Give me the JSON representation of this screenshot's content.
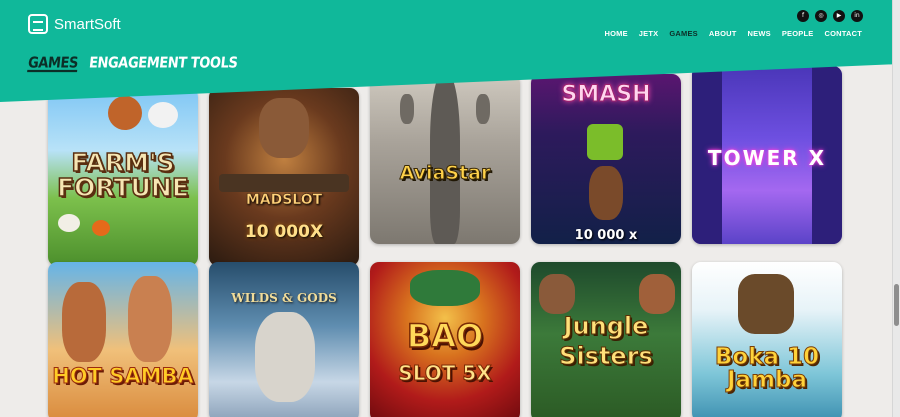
{
  "brand": {
    "name": "SmartSoft",
    "accent": "#10b89a"
  },
  "socials": [
    {
      "icon": "facebook-icon",
      "glyph": "f"
    },
    {
      "icon": "instagram-icon",
      "glyph": "◎"
    },
    {
      "icon": "youtube-icon",
      "glyph": "▶"
    },
    {
      "icon": "linkedin-icon",
      "glyph": "in"
    }
  ],
  "nav": {
    "items": [
      "HOME",
      "JETX",
      "GAMES",
      "ABOUT",
      "NEWS",
      "PEOPLE",
      "CONTACT"
    ],
    "active": "GAMES"
  },
  "subnav": {
    "items": [
      "GAMES",
      "ENGAGEMENT TOOLS"
    ],
    "active": "GAMES"
  },
  "games": [
    {
      "title": "FARM'S FORTUNE",
      "subtitle": ""
    },
    {
      "title": "MADSLOT",
      "subtitle": "10 000X"
    },
    {
      "title": "AviaStar",
      "subtitle": ""
    },
    {
      "title": "SMASH",
      "subtitle": "10 000 x"
    },
    {
      "title": "TOWER X",
      "subtitle": ""
    },
    {
      "title": "HOT SAMBA",
      "subtitle": ""
    },
    {
      "title": "WILDS & GODS",
      "subtitle": ""
    },
    {
      "title": "BAO",
      "subtitle": "SLOT 5X"
    },
    {
      "title": "Jungle",
      "subtitle": "Sisters"
    },
    {
      "title": "Boka 10 Jamba",
      "subtitle": ""
    }
  ]
}
